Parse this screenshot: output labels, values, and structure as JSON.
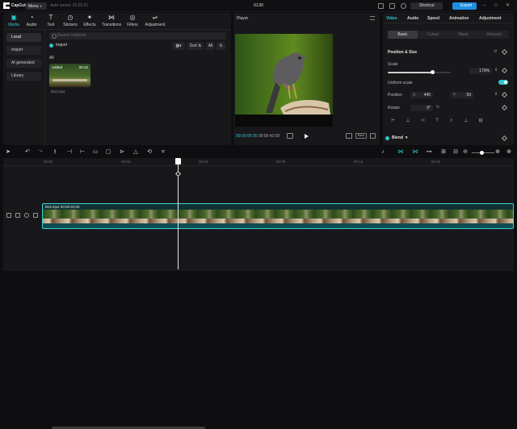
{
  "app": {
    "name": "CapCut",
    "menu_label": "Menu",
    "autosave": "Auto saved: 22:25:51",
    "project_title": "0130",
    "shortcut_label": "Shortcut",
    "export_label": "Export"
  },
  "media": {
    "tabs": [
      {
        "label": "Media",
        "icon": "media-icon"
      },
      {
        "label": "Audio",
        "icon": "audio-icon"
      },
      {
        "label": "Text",
        "icon": "text-icon"
      },
      {
        "label": "Stickers",
        "icon": "stickers-icon"
      },
      {
        "label": "Effects",
        "icon": "effects-icon"
      },
      {
        "label": "Transitions",
        "icon": "transitions-icon"
      },
      {
        "label": "Filters",
        "icon": "filters-icon"
      },
      {
        "label": "Adjustment",
        "icon": "adjustment-icon"
      }
    ],
    "sidebar": [
      "Local",
      "Import",
      "AI generated",
      "Library"
    ],
    "search_placeholder": "Search material",
    "import_label": "Import",
    "sort_label": "Sort",
    "all_filter": "All",
    "all_label": "All",
    "item": {
      "badge": "Added",
      "duration": "00:42",
      "name": "bird.mp4"
    }
  },
  "player": {
    "title": "Player",
    "current_time": "00:00:05:05",
    "total_time": "00:00:42:00",
    "ratio_label": "Ratio"
  },
  "properties": {
    "tabs": [
      "Video",
      "Audio",
      "Speed",
      "Animation",
      "Adjustment"
    ],
    "subtabs": [
      "Basic",
      "Cutout",
      "Mask",
      "Retouch"
    ],
    "position_size_title": "Position & Size",
    "scale_label": "Scale",
    "scale_value": "170%",
    "scale_fraction": 0.7,
    "uniform_scale_label": "Uniform scale",
    "position_label": "Position",
    "pos_x_prefix": "X",
    "pos_x": "445",
    "pos_y_prefix": "Y",
    "pos_y": "59",
    "rotate_label": "Rotate",
    "rotate_value": "0°",
    "blend_label": "Blend"
  },
  "timeline": {
    "ruler": [
      "00:00",
      "00:03",
      "00:06",
      "00:09",
      "00:12",
      "00:15"
    ],
    "clip_name": "bird.mp4",
    "clip_duration": "00:00:42:00"
  },
  "colors": {
    "accent": "#2fc6d1",
    "export": "#1e8fe1",
    "panel": "#18181b"
  }
}
